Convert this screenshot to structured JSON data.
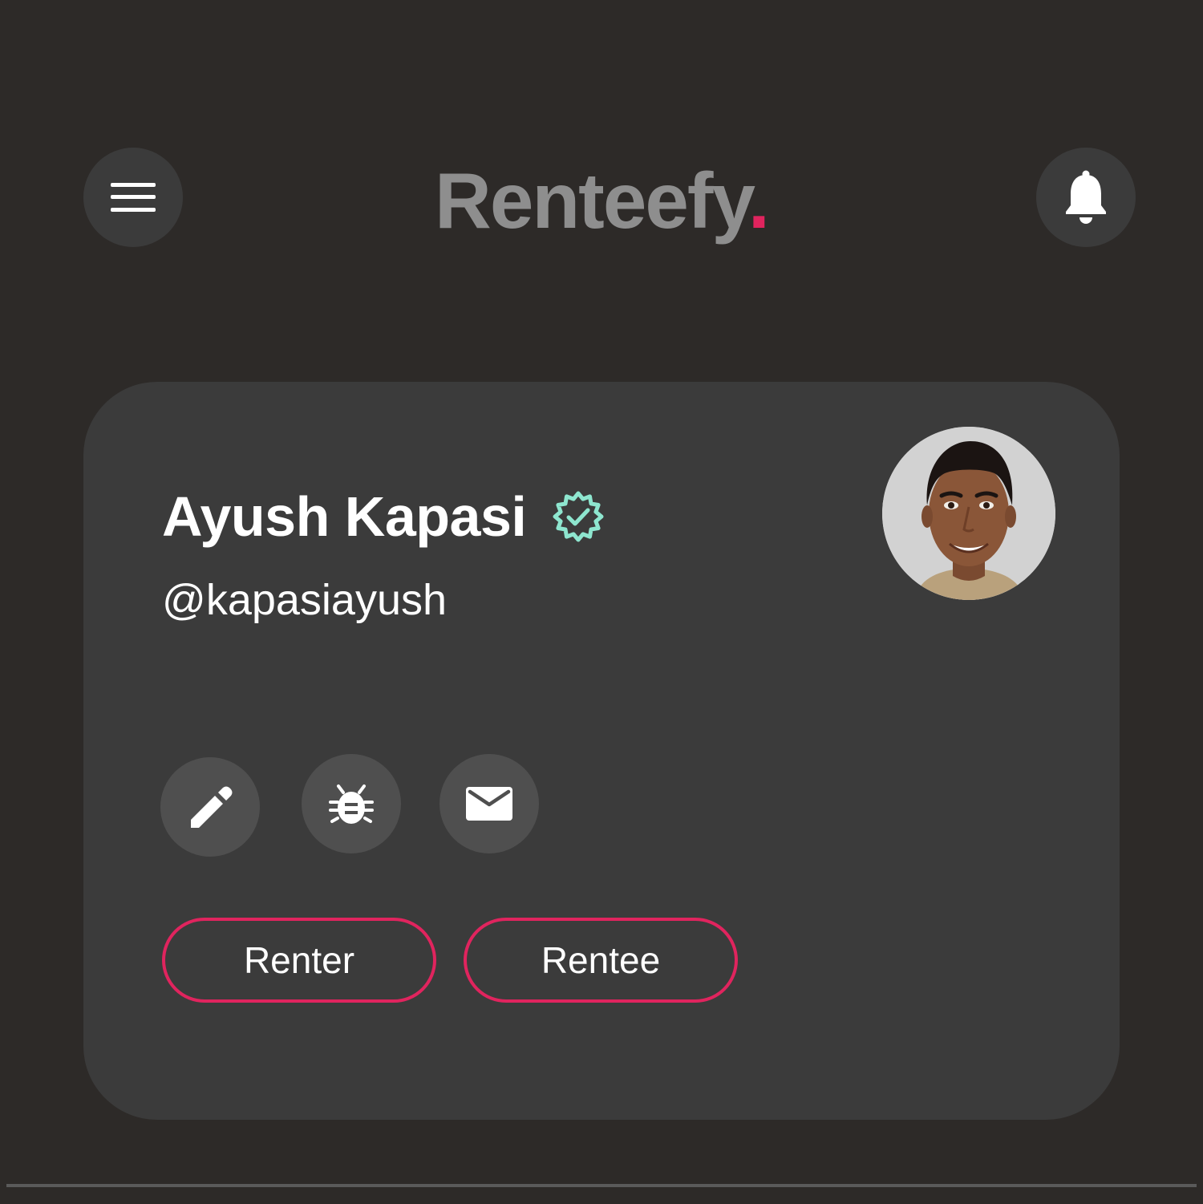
{
  "header": {
    "brand": "Renteefy",
    "brand_dot": ".",
    "menu_icon": "hamburger-menu-icon",
    "notification_icon": "bell-icon"
  },
  "profile": {
    "name": "Ayush Kapasi",
    "handle": "@kapasiayush",
    "verified_icon": "verified-badge-icon",
    "avatar_icon": "avatar-photo",
    "actions": [
      {
        "icon": "pencil-icon",
        "label": "edit"
      },
      {
        "icon": "bug-icon",
        "label": "report bug"
      },
      {
        "icon": "mail-icon",
        "label": "message"
      }
    ],
    "roles": [
      "Renter",
      "Rentee"
    ]
  },
  "colors": {
    "background": "#2d2a28",
    "card": "#3b3b3b",
    "accent": "#e0245e",
    "verified": "#8ee6cf",
    "brand_text": "#8e8e8e"
  }
}
